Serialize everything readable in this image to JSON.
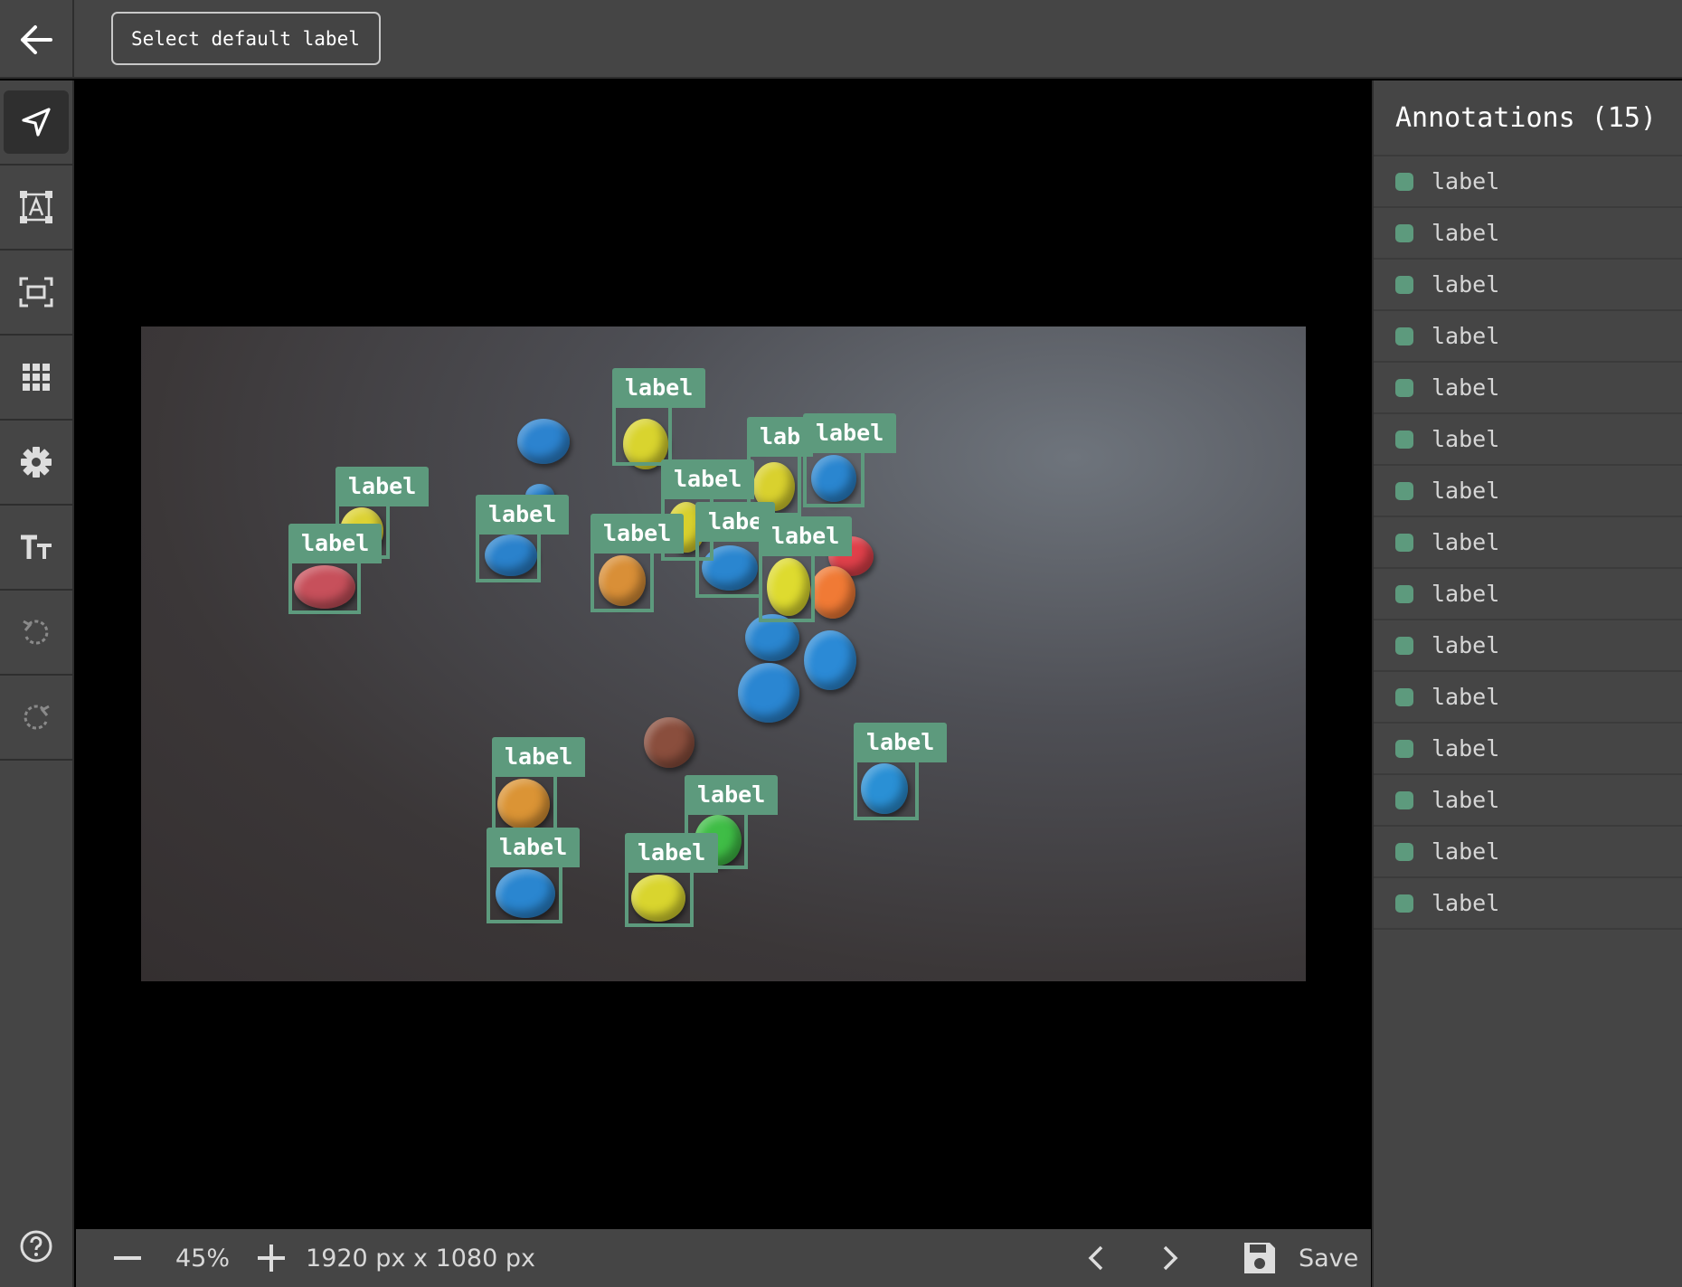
{
  "topbar": {
    "default_label_button": "Select default label"
  },
  "toolbar": {
    "tools": [
      "select-tool",
      "annotate-text-tool",
      "bounding-box-tool",
      "grid-tool",
      "settings-tool",
      "text-size-tool",
      "undo-tool",
      "redo-tool"
    ]
  },
  "annotations_panel": {
    "title": "Annotations (15)",
    "items": [
      "label",
      "label",
      "label",
      "label",
      "label",
      "label",
      "label",
      "label",
      "label",
      "label",
      "label",
      "label",
      "label",
      "label",
      "label"
    ]
  },
  "boxes": {
    "labels": [
      "label",
      "label",
      "label",
      "lab",
      "label",
      "label",
      "label",
      "label",
      "labe",
      "label",
      "label",
      "label",
      "label",
      "label",
      "label"
    ]
  },
  "bottombar": {
    "zoom": "45%",
    "dimensions": "1920 px x 1080 px",
    "save_label": "Save"
  },
  "colors": {
    "accent": "#5d9a7d",
    "panel_bg": "#454545",
    "canvas_bg": "#000000"
  }
}
